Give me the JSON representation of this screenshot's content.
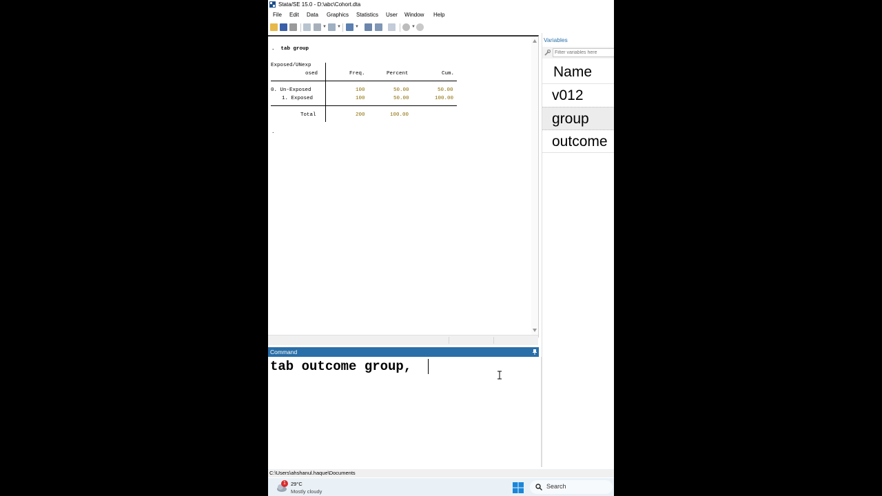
{
  "window": {
    "title": "Stata/SE 15.0 - D:\\abc\\Cohort.dta"
  },
  "menu": [
    "File",
    "Edit",
    "Data",
    "Graphics",
    "Statistics",
    "User",
    "Window",
    "Help"
  ],
  "results": {
    "command_line": ".  tab group",
    "header_row1": "Exposed/UNexp",
    "header_row2": "osed",
    "col_freq": "Freq.",
    "col_percent": "Percent",
    "col_cum": "Cum.",
    "rows": [
      {
        "label": "0. Un-Exposed",
        "freq": "100",
        "percent": "50.00",
        "cum": "50.00"
      },
      {
        "label": "1. Exposed",
        "freq": "100",
        "percent": "50.00",
        "cum": "100.00"
      }
    ],
    "total": {
      "label": "Total",
      "freq": "200",
      "percent": "100.00"
    },
    "prompt": "."
  },
  "command": {
    "title": "Command",
    "pin_icon": "pin-icon",
    "value": "tab outcome group,"
  },
  "variables": {
    "title": "Variables",
    "filter_placeholder": "Filter variables here",
    "header": "Name",
    "items": [
      "v012",
      "group",
      "outcome"
    ],
    "selected": "group"
  },
  "statusbar": {
    "path": "C:\\Users\\ahshanul.haque\\Documents"
  },
  "taskbar": {
    "notification_count": "1",
    "temperature": "29°C",
    "weather": "Mostly cloudy",
    "search_label": "Search"
  },
  "colors": {
    "command_header": "#2a6fa8",
    "number_color": "#8a6a00",
    "selected_row": "#ececec"
  }
}
